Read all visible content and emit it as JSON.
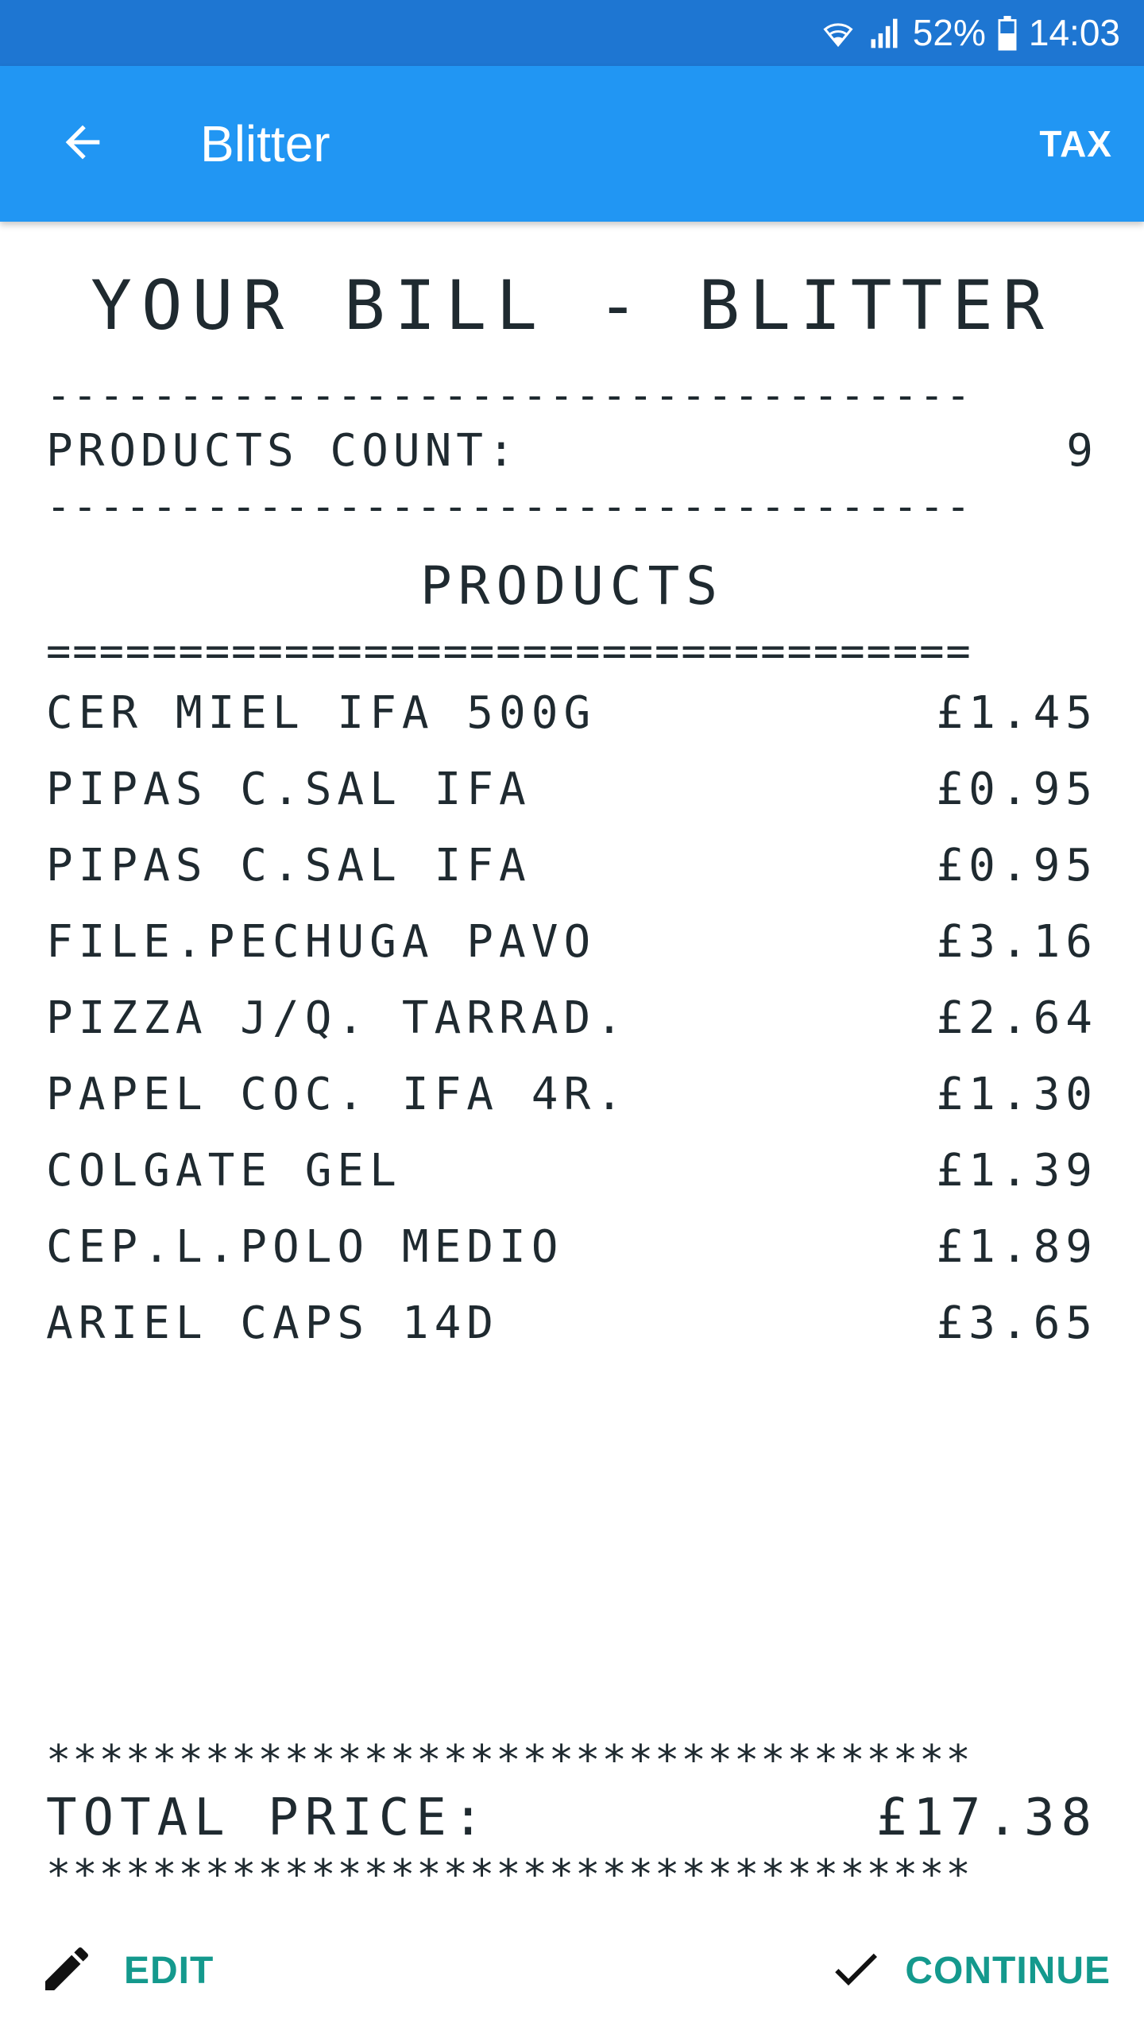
{
  "status_bar": {
    "battery": "52%",
    "time": "14:03",
    "icons": [
      "wifi-icon",
      "signal-icon",
      "battery-icon"
    ]
  },
  "app_bar": {
    "title": "Blitter",
    "action": "TAX",
    "back_icon": "arrow-back-icon"
  },
  "receipt": {
    "title": "YOUR BILL - BLITTER",
    "dash_line": "-----------------------------------",
    "equals_line": "===================================",
    "star_line": "***********************************",
    "products_count_label": "PRODUCTS COUNT:",
    "products_count": "9",
    "products_heading": "PRODUCTS",
    "items": [
      {
        "name": "CER MIEL IFA 500G",
        "price": "£1.45"
      },
      {
        "name": "PIPAS C.SAL IFA",
        "price": "£0.95"
      },
      {
        "name": "PIPAS C.SAL IFA",
        "price": "£0.95"
      },
      {
        "name": "FILE.PECHUGA PAVO",
        "price": "£3.16"
      },
      {
        "name": "PIZZA J/Q. TARRAD.",
        "price": "£2.64"
      },
      {
        "name": "PAPEL COC. IFA 4R.",
        "price": "£1.30"
      },
      {
        "name": "COLGATE GEL",
        "price": "£1.39"
      },
      {
        "name": "CEP.L.POLO MEDIO",
        "price": "£1.89"
      },
      {
        "name": "ARIEL CAPS 14D",
        "price": "£3.65"
      }
    ],
    "total_label": "TOTAL PRICE:",
    "total_value": "£17.38"
  },
  "actions": {
    "edit_label": "EDIT",
    "continue_label": "CONTINUE"
  },
  "colors": {
    "status_bar": "#1e76d2",
    "app_bar": "#2196f3",
    "accent": "#14998d",
    "receipt_text": "#1f2a30"
  }
}
